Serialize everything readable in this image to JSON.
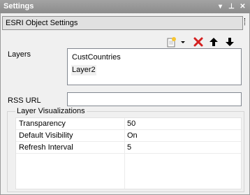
{
  "window": {
    "title": "Settings",
    "buttons": {
      "dropdown": "▾",
      "pin": "⊥",
      "close": "✕"
    }
  },
  "section_header": "ESRI Object Settings",
  "toolbar": {
    "icons": [
      "new-layer-icon",
      "chevron-down-icon",
      "delete-icon",
      "arrow-up-icon",
      "arrow-down-icon"
    ]
  },
  "layers": {
    "label": "Layers",
    "items": [
      {
        "name": "CustCountries",
        "selected": false
      },
      {
        "name": "Layer2",
        "selected": true
      }
    ]
  },
  "rss": {
    "label": "RSS URL",
    "value": ""
  },
  "visualizations": {
    "title": "Layer Visualizations",
    "rows": [
      {
        "key": "Transparency",
        "value": "50"
      },
      {
        "key": "Default Visibility",
        "value": "On"
      },
      {
        "key": "Refresh Interval",
        "value": "5"
      }
    ]
  },
  "colors": {
    "titlebar": "#8c8c8c",
    "delete": "#d42020"
  }
}
